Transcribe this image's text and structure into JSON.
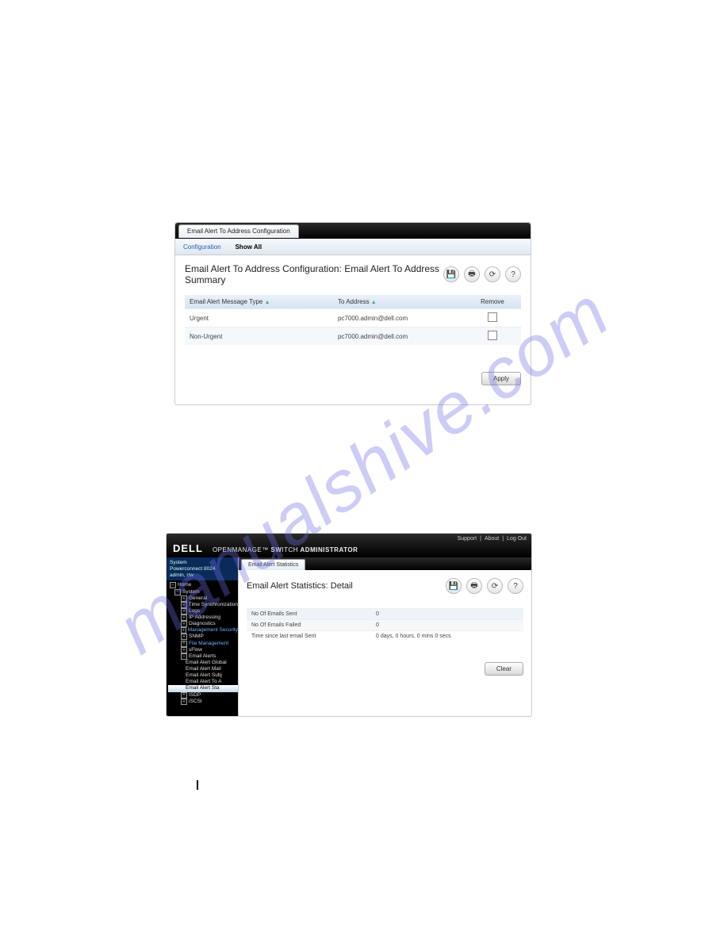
{
  "watermark": "manualshive.com",
  "panel1": {
    "active_tab": "Email Alert To Address Configuration",
    "subtabs": {
      "configuration": "Configuration",
      "showall": "Show All"
    },
    "heading": "Email Alert To Address Configuration: Email Alert To Address Summary",
    "columns": {
      "type": "Email Alert Message Type",
      "to": "To Address",
      "remove": "Remove"
    },
    "rows": [
      {
        "type": "Urgent",
        "to": "pc7000.admin@dell.com"
      },
      {
        "type": "Non-Urgent",
        "to": "pc7000.admin@dell.com"
      }
    ],
    "apply": "Apply"
  },
  "panel2": {
    "topnav": {
      "support": "Support",
      "about": "About",
      "logout": "Log Out"
    },
    "brand": "DELL",
    "product_prefix": "OPENMANAGE™ ",
    "product_sw": "SW",
    "product_itch": "ITCH",
    "product_admin": " ADMINISTRATOR",
    "sysinfo": {
      "l1": "System",
      "l2": "Powerconnect 8024",
      "l3": "admin, r/w"
    },
    "tree": [
      {
        "indent": 0,
        "kind": "minus",
        "label": "Home"
      },
      {
        "indent": 1,
        "kind": "minus",
        "label": "System"
      },
      {
        "indent": 2,
        "kind": "plus",
        "label": "General"
      },
      {
        "indent": 2,
        "kind": "plus",
        "label": "Time Synchronization"
      },
      {
        "indent": 2,
        "kind": "plus",
        "label": "Logs"
      },
      {
        "indent": 2,
        "kind": "plus",
        "label": "IP Addressing"
      },
      {
        "indent": 2,
        "kind": "plus",
        "label": "Diagnostics"
      },
      {
        "indent": 2,
        "kind": "plus",
        "label": "Management Security",
        "link": true
      },
      {
        "indent": 2,
        "kind": "plus",
        "label": "SNMP"
      },
      {
        "indent": 2,
        "kind": "plus",
        "label": "File Management",
        "link": true
      },
      {
        "indent": 2,
        "kind": "plus",
        "label": "sFlow"
      },
      {
        "indent": 2,
        "kind": "minus",
        "label": "Email Alerts"
      },
      {
        "indent": 3,
        "kind": "leaf",
        "label": "Email Alert Global"
      },
      {
        "indent": 3,
        "kind": "leaf",
        "label": "Email Alert Mail"
      },
      {
        "indent": 3,
        "kind": "leaf",
        "label": "Email Alert Subj"
      },
      {
        "indent": 3,
        "kind": "leaf",
        "label": "Email Alert To A"
      },
      {
        "indent": 3,
        "kind": "leaf",
        "label": "Email Alert Sta",
        "selected": true
      },
      {
        "indent": 2,
        "kind": "plus",
        "label": "ISDP"
      },
      {
        "indent": 2,
        "kind": "plus",
        "label": "iSCSI"
      }
    ],
    "active_tab": "Email Alert Statistics",
    "heading": "Email Alert Statistics: Detail",
    "rows": [
      {
        "k": "No Of Emails Sent",
        "v": "0"
      },
      {
        "k": "No Of Emails Failed",
        "v": "0"
      },
      {
        "k": "Time since last email Sent",
        "v": "0 days, 0 hours, 0 mins 0 secs"
      }
    ],
    "clear": "Clear"
  },
  "glyph": {
    "save": "💾",
    "print": "🖶",
    "refresh": "⟳",
    "help": "?",
    "sort": "▲"
  }
}
